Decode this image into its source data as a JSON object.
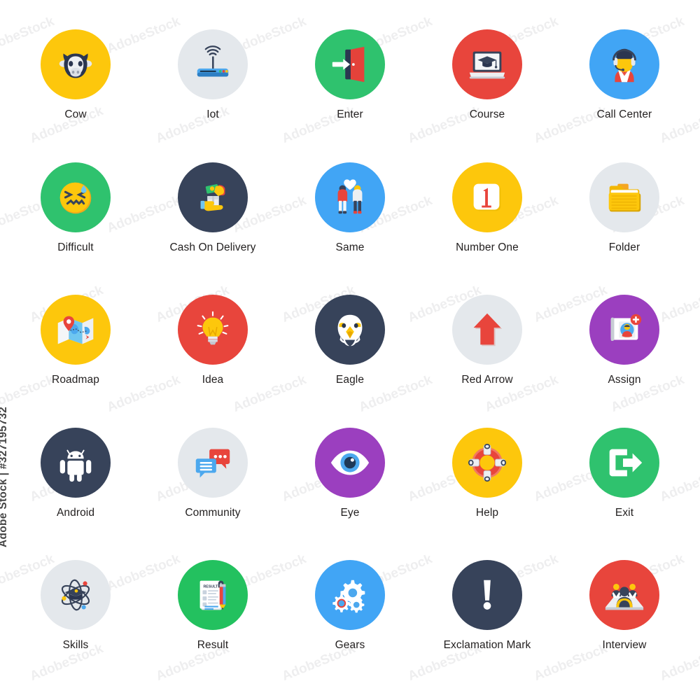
{
  "page": {
    "background": "#ffffff",
    "label_color": "#221f1f",
    "columns": 5,
    "rows": 5
  },
  "watermark": {
    "text": "Adobe Stock | #327195732",
    "tile_text": "AdobeStock"
  },
  "palette": {
    "yellow": "#FDC70C",
    "grey": "#E4E8EC",
    "green": "#2FC26E",
    "red": "#E8453C",
    "blue": "#41A5F5",
    "navy": "#37435A",
    "purple": "#9B3FBF",
    "emerald": "#23C15F"
  },
  "icons": [
    {
      "label": "Cow",
      "icon": "cow-icon",
      "bg": "#FDC70C"
    },
    {
      "label": "Iot",
      "icon": "router-icon",
      "bg": "#E4E8EC"
    },
    {
      "label": "Enter",
      "icon": "enter-door-icon",
      "bg": "#2FC26E"
    },
    {
      "label": "Course",
      "icon": "laptop-graduation-icon",
      "bg": "#E8453C"
    },
    {
      "label": "Call Center",
      "icon": "headset-agent-icon",
      "bg": "#41A5F5"
    },
    {
      "label": "Difficult",
      "icon": "confounded-face-icon",
      "bg": "#2FC26E"
    },
    {
      "label": "Cash On Delivery",
      "icon": "cash-on-delivery-icon",
      "bg": "#37435A"
    },
    {
      "label": "Same",
      "icon": "couple-heart-icon",
      "bg": "#41A5F5"
    },
    {
      "label": "Number One",
      "icon": "number-one-icon",
      "bg": "#FDC70C"
    },
    {
      "label": "Folder",
      "icon": "folder-icon",
      "bg": "#E4E8EC"
    },
    {
      "label": "Roadmap",
      "icon": "map-pin-icon",
      "bg": "#FDC70C"
    },
    {
      "label": "Idea",
      "icon": "lightbulb-icon",
      "bg": "#E8453C"
    },
    {
      "label": "Eagle",
      "icon": "eagle-icon",
      "bg": "#37435A"
    },
    {
      "label": "Red Arrow",
      "icon": "arrow-up-icon",
      "bg": "#E4E8EC"
    },
    {
      "label": "Assign",
      "icon": "assign-user-icon",
      "bg": "#9B3FBF"
    },
    {
      "label": "Android",
      "icon": "android-icon",
      "bg": "#37435A"
    },
    {
      "label": "Community",
      "icon": "chat-bubbles-icon",
      "bg": "#E4E8EC"
    },
    {
      "label": "Eye",
      "icon": "eye-icon",
      "bg": "#9B3FBF"
    },
    {
      "label": "Help",
      "icon": "lifebuoy-icon",
      "bg": "#FDC70C"
    },
    {
      "label": "Exit",
      "icon": "exit-arrow-icon",
      "bg": "#2FC26E"
    },
    {
      "label": "Skills",
      "icon": "atom-graduation-icon",
      "bg": "#E4E8EC"
    },
    {
      "label": "Result",
      "icon": "result-sheet-icon",
      "bg": "#23C15F"
    },
    {
      "label": "Gears",
      "icon": "gears-icon",
      "bg": "#41A5F5"
    },
    {
      "label": "Exclamation Mark",
      "icon": "exclamation-icon",
      "bg": "#37435A"
    },
    {
      "label": "Interview",
      "icon": "interview-icon",
      "bg": "#E8453C"
    }
  ]
}
